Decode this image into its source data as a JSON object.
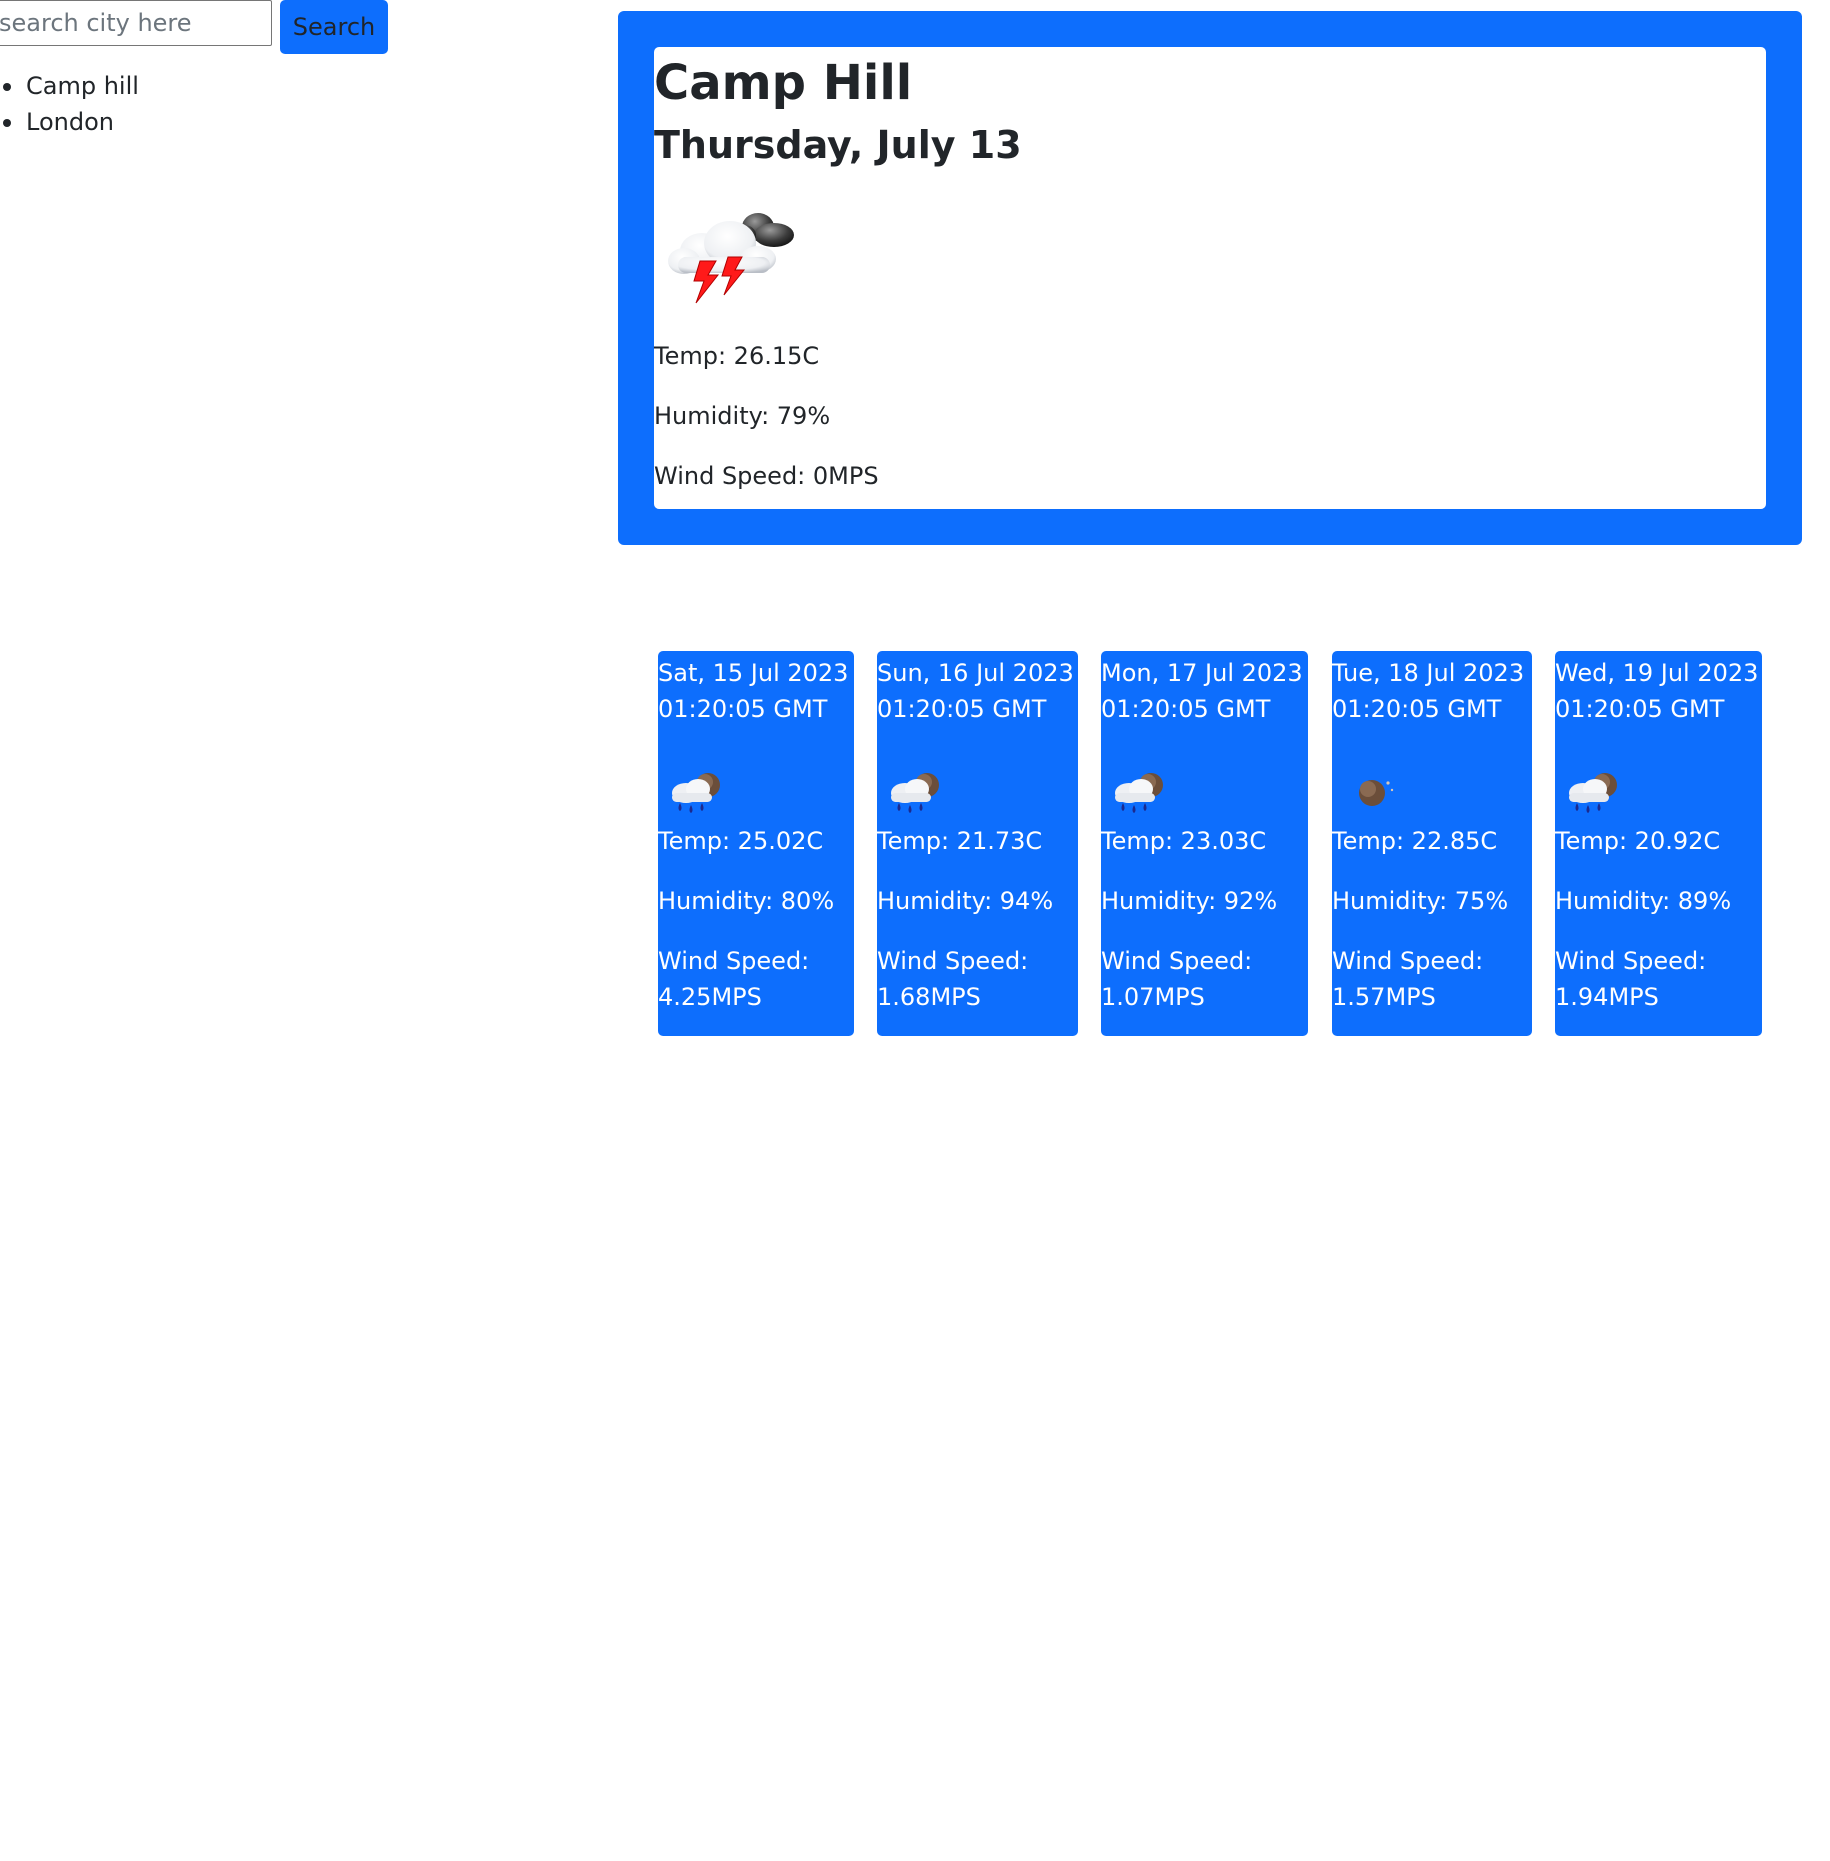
{
  "search": {
    "placeholder": "search city here",
    "button_label": "Search"
  },
  "history": [
    {
      "label": "Camp hill"
    },
    {
      "label": "London"
    }
  ],
  "current": {
    "city": "Camp Hill",
    "date": "Thursday, July 13",
    "icon": "thunderstorm-icon",
    "temp": "Temp: 26.15C",
    "humidity": "Humidity: 79%",
    "wind": "Wind Speed: 0MPS"
  },
  "forecast": [
    {
      "date_line1": "Sat, 15 Jul 2023",
      "date_line2": "01:20:05 GMT",
      "icon": "rain-cloud-icon",
      "temp": "Temp: 25.02C",
      "humidity": "Humidity: 80%",
      "wind_label": "Wind Speed:",
      "wind_value": "4.25MPS"
    },
    {
      "date_line1": "Sun, 16 Jul 2023",
      "date_line2": "01:20:05 GMT",
      "icon": "rain-cloud-icon",
      "temp": "Temp: 21.73C",
      "humidity": "Humidity: 94%",
      "wind_label": "Wind Speed:",
      "wind_value": "1.68MPS"
    },
    {
      "date_line1": "Mon, 17 Jul 2023",
      "date_line2": "01:20:05 GMT",
      "icon": "rain-cloud-icon",
      "temp": "Temp: 23.03C",
      "humidity": "Humidity: 92%",
      "wind_label": "Wind Speed:",
      "wind_value": "1.07MPS"
    },
    {
      "date_line1": "Tue, 18 Jul 2023",
      "date_line2": "01:20:05 GMT",
      "icon": "moon-icon",
      "temp": "Temp: 22.85C",
      "humidity": "Humidity: 75%",
      "wind_label": "Wind Speed:",
      "wind_value": "1.57MPS"
    },
    {
      "date_line1": "Wed, 19 Jul 2023",
      "date_line2": "01:20:05 GMT",
      "icon": "rain-cloud-icon",
      "temp": "Temp: 20.92C",
      "humidity": "Humidity: 89%",
      "wind_label": "Wind Speed:",
      "wind_value": "1.94MPS"
    }
  ],
  "colors": {
    "primary": "#0d6efd",
    "text": "#212529"
  }
}
